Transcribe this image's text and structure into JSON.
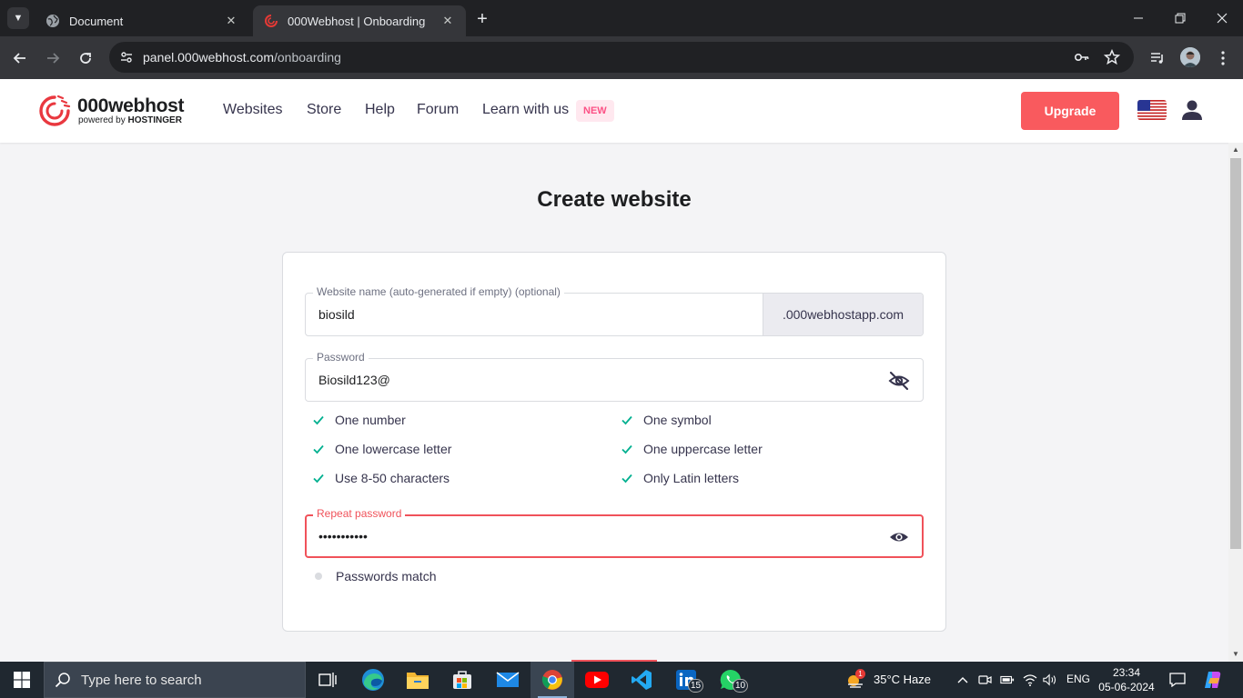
{
  "browser": {
    "tabs": [
      {
        "title": "Document"
      },
      {
        "title": "000Webhost | Onboarding"
      }
    ],
    "url_host": "panel.000webhost.com",
    "url_path": "/onboarding"
  },
  "header": {
    "logo_name": "000webhost",
    "logo_sub_prefix": "powered by ",
    "logo_sub_brand": "HOSTINGER",
    "nav": [
      "Websites",
      "Store",
      "Help",
      "Forum",
      "Learn with us"
    ],
    "new_badge": "NEW",
    "upgrade_label": "Upgrade"
  },
  "form": {
    "title": "Create website",
    "website_name_label": "Website name (auto-generated if empty) (optional)",
    "website_name_value": "biosild",
    "domain_suffix": ".000webhostapp.com",
    "password_label": "Password",
    "password_value": "Biosild123@",
    "requirements": [
      {
        "text": "One number",
        "met": true
      },
      {
        "text": "One symbol",
        "met": true
      },
      {
        "text": "One lowercase letter",
        "met": true
      },
      {
        "text": "One uppercase letter",
        "met": true
      },
      {
        "text": "Use 8-50 characters",
        "met": true
      },
      {
        "text": "Only Latin letters",
        "met": true
      }
    ],
    "repeat_label": "Repeat password",
    "repeat_value": "•••••••••••",
    "match_text": "Passwords match",
    "accent_error": "#f0525a",
    "accent_check": "#00b090"
  },
  "taskbar": {
    "search_placeholder": "Type here to search",
    "linkedin_badge": "15",
    "whatsapp_badge": "10",
    "weather_badge": "1",
    "weather": "35°C  Haze",
    "lang": "ENG",
    "time": "23:34",
    "date": "05-06-2024"
  }
}
